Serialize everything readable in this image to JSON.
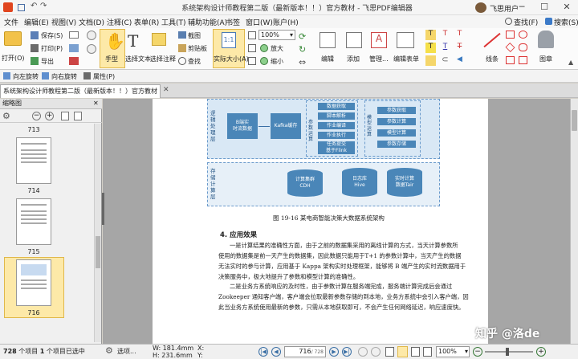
{
  "titlebar": {
    "title": "系统架构设计师教程第二版（最新版本！！）官方教材 - 飞思PDF编辑器",
    "user": "飞思用户"
  },
  "menu": [
    "文件",
    "编辑(E)",
    "视图(V)",
    "文档(D)",
    "注释(C)",
    "表单(R)",
    "工具(T)",
    "辅助功能(A)",
    "书签",
    "窗口(W)",
    "账户(H)"
  ],
  "menu_right": {
    "find": "查找(F)",
    "search": "搜索(S)"
  },
  "ribbon": {
    "open": "打开(O)",
    "save": "保存(S)",
    "print": "打印(P)",
    "export": "导出",
    "hand": "手型",
    "select_text": "选择文本",
    "select_annot": "选择注释",
    "screenshot": "截图",
    "clipboard": "剪贴板",
    "find": "查找",
    "actual_size": "实际大小(A)",
    "zoom": "100%",
    "zoom_in": "放大",
    "zoom_out": "缩小",
    "edit": "编辑",
    "add": "添加",
    "manage": "管理...",
    "edit_form": "编辑表单",
    "line": "线条",
    "stamp": "图章"
  },
  "quickbar": {
    "rotate_right": "向左旋转",
    "rotate_left": "向右旋转",
    "properties": "属性(P)"
  },
  "tab": {
    "label": "系统架构设计师教程第二版（最新版本！！）官方教材"
  },
  "leftpanel": {
    "title": "缩略图",
    "pages": [
      "713",
      "714",
      "715",
      "716"
    ]
  },
  "statusbar": {
    "count": "728",
    "count_text": "个项目  ",
    "selected": "1",
    "selected_text": "个项目已选中",
    "options": "选项...",
    "w": "W: 181.4mm",
    "h": "H: 231.6mm",
    "x": "X:",
    "y": "Y:",
    "page": "716",
    "page_total": "/ 728",
    "zoom": "100%"
  },
  "document": {
    "diagram": {
      "left_top": "逻辑处理层",
      "left_bottom": "存储计算层",
      "b_model": "B端实\n时流数据",
      "kafka": "Kafka缓存",
      "calc_label": "参数运算",
      "model_label": "模型运算",
      "calc_items": [
        "数据获取",
        "脚本解析",
        "作业编译",
        "作业执行",
        "任务提交\n基于Flink"
      ],
      "model_items": [
        "参数获取",
        "参数计算",
        "模型计算",
        "参数存储"
      ],
      "db1": "计算集群\nCDH",
      "db2": "日志库\nHive",
      "db3": "实时计算\n数据Tair"
    },
    "figure_caption": "图 19-16  某电商智能决策大数据系统架构",
    "heading": "4. 应用效果",
    "lines": [
      "一是计算结果的准确性方面，由于之前的数据集采用的离线计算的方式，当天计算参数所",
      "使用的数据集是前一天产生的数据集，因此数据只能用于T+1 的参数计算中，当天产生的数据",
      "无法实时的参与计算，应用基于 Kappa 架构实时处理框架，能够将 B 端产生的实时流数据用于",
      "决策服务中，极大地提升了参数和模型计算的准确性。",
      "二是业务方系统响应的及时性，由于参数计算在服务端完成，服务端计算完成后会通过",
      "Zookeeper 通知客户端，客户端会拉取最新参数存储的到本地，业务方系统中会引入客户端，因",
      "此当业务方系统使用最新的参数，只需从本地获取即可，不会产生任何网络延迟，响应速度快。"
    ]
  },
  "watermark": "知乎 @洛de"
}
